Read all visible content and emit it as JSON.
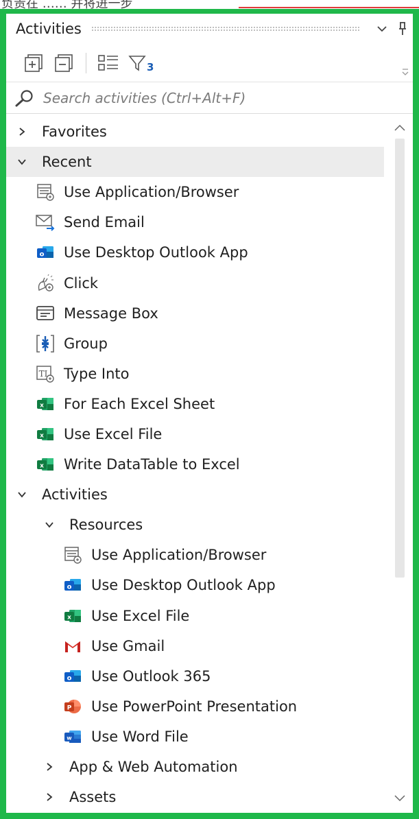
{
  "top_strip_text": "负责在 …… 并将进一步",
  "panel": {
    "title": "Activities",
    "filter_count": "3",
    "search_placeholder": "Search activities (Ctrl+Alt+F)"
  },
  "colors": {
    "frame": "#1fb84a",
    "selected_row": "#ececec",
    "accent_blue": "#1a5db5"
  },
  "tree": [
    {
      "label": "Favorites",
      "level": 0,
      "chevron": "right",
      "icon": null
    },
    {
      "label": "Recent",
      "level": 0,
      "chevron": "down",
      "icon": null,
      "selected": true
    },
    {
      "label": "Use Application/Browser",
      "level": 1,
      "icon": "app-browser-icon"
    },
    {
      "label": "Send Email",
      "level": 1,
      "icon": "send-email-icon"
    },
    {
      "label": "Use Desktop Outlook App",
      "level": 1,
      "icon": "outlook-icon"
    },
    {
      "label": "Click",
      "level": 1,
      "icon": "click-icon"
    },
    {
      "label": "Message Box",
      "level": 1,
      "icon": "message-box-icon"
    },
    {
      "label": "Group",
      "level": 1,
      "icon": "group-icon"
    },
    {
      "label": "Type Into",
      "level": 1,
      "icon": "type-into-icon"
    },
    {
      "label": "For Each Excel Sheet",
      "level": 1,
      "icon": "excel-icon"
    },
    {
      "label": "Use Excel File",
      "level": 1,
      "icon": "excel-icon"
    },
    {
      "label": "Write DataTable to Excel",
      "level": 1,
      "icon": "excel-icon"
    },
    {
      "label": "Activities",
      "level": 0,
      "chevron": "down",
      "icon": null
    },
    {
      "label": "Resources",
      "level": 1,
      "chevron": "down",
      "icon": null
    },
    {
      "label": "Use Application/Browser",
      "level": 2,
      "icon": "app-browser-icon"
    },
    {
      "label": "Use Desktop Outlook App",
      "level": 2,
      "icon": "outlook-icon"
    },
    {
      "label": "Use Excel File",
      "level": 2,
      "icon": "excel-icon"
    },
    {
      "label": "Use Gmail",
      "level": 2,
      "icon": "gmail-icon"
    },
    {
      "label": "Use Outlook 365",
      "level": 2,
      "icon": "outlook-icon"
    },
    {
      "label": "Use PowerPoint Presentation",
      "level": 2,
      "icon": "powerpoint-icon"
    },
    {
      "label": "Use Word File",
      "level": 2,
      "icon": "word-icon"
    },
    {
      "label": "App & Web Automation",
      "level": 1,
      "chevron": "right",
      "icon": null
    },
    {
      "label": "Assets",
      "level": 1,
      "chevron": "right",
      "icon": null
    }
  ]
}
